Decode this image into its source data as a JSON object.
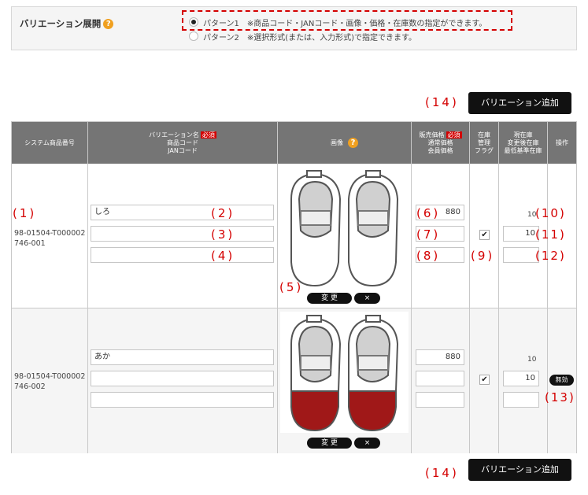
{
  "variation": {
    "label": "バリエーション展開",
    "help_icon": "question-icon",
    "pattern1": "パターン1　※商品コード・JANコード・画像・価格・在庫数の指定ができます。",
    "pattern2": "パターン2　※選択形式(または、入力形式)で指定できます。",
    "selected": "pattern1"
  },
  "add_button": "バリエーション追加",
  "annotations": {
    "n1": "(1)",
    "n2": "(2)",
    "n3": "(3)",
    "n4": "(4)",
    "n5": "(5)",
    "n6": "(6)",
    "n7": "(7)",
    "n8": "(8)",
    "n9": "(9)",
    "n10": "(10)",
    "n11": "(11)",
    "n12": "(12)",
    "n13": "(13)",
    "n14": "(14)"
  },
  "table": {
    "headers": {
      "system_no": "システム商品番号",
      "variation_name": "バリエーション名",
      "product_code": "商品コード",
      "jan_code": "JANコード",
      "image": "画像",
      "sale_price": "販売価格",
      "regular_price": "通常価格",
      "member_price": "会員価格",
      "stock_flag_1": "在庫",
      "stock_flag_2": "管理",
      "stock_flag_3": "フラグ",
      "current_stock": "現在庫",
      "changed_stock": "変更後在庫",
      "min_stock": "最低基準在庫",
      "action": "操作",
      "required": "必須"
    },
    "rows": [
      {
        "system_no_1": "98-01504-T000002",
        "system_no_2": "746-001",
        "name": "しろ",
        "product_code": "",
        "jan_code": "",
        "sale_price": "880",
        "regular_price": "",
        "member_price": "",
        "stock_managed": true,
        "current_stock": "10",
        "changed_stock": "10",
        "min_stock": "",
        "shoe_color": "#ffffff",
        "change_label": "変 更",
        "delete_label": "×"
      },
      {
        "system_no_1": "98-01504-T000002",
        "system_no_2": "746-002",
        "name": "あか",
        "product_code": "",
        "jan_code": "",
        "sale_price": "880",
        "regular_price": "",
        "member_price": "",
        "stock_managed": true,
        "current_stock": "10",
        "changed_stock": "10",
        "min_stock": "",
        "shoe_color": "#a01818",
        "change_label": "変 更",
        "delete_label": "×",
        "disable_label": "無効"
      }
    ]
  }
}
